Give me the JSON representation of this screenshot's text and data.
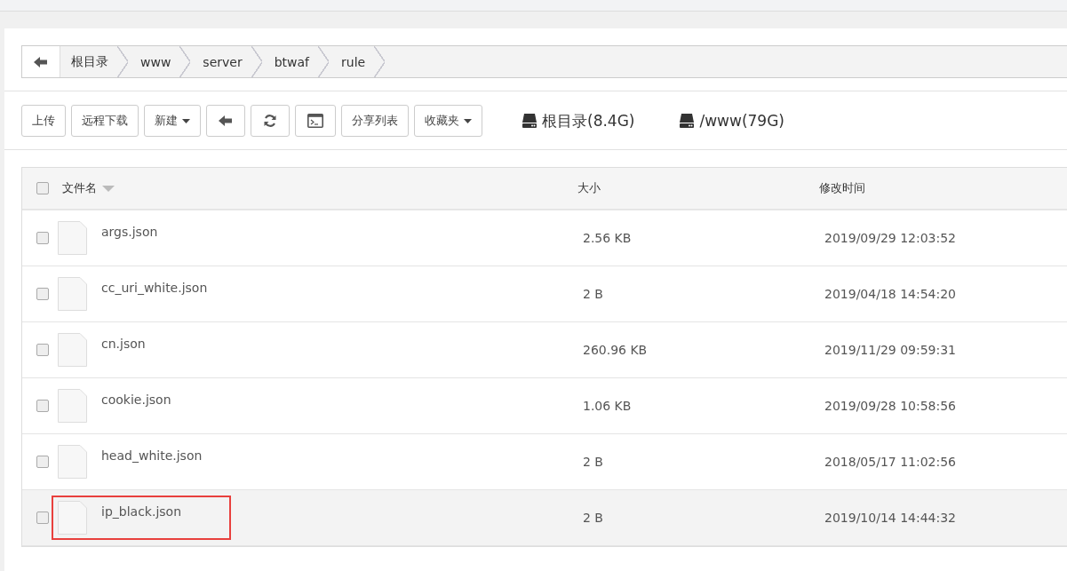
{
  "breadcrumb": {
    "crumbs": [
      "根目录",
      "www",
      "server",
      "btwaf",
      "rule"
    ]
  },
  "toolbar": {
    "buttons": [
      {
        "kind": "text",
        "label": "上传"
      },
      {
        "kind": "text",
        "label": "远程下载"
      },
      {
        "kind": "dropdown",
        "label": "新建"
      },
      {
        "kind": "back"
      },
      {
        "kind": "refresh"
      },
      {
        "kind": "terminal"
      },
      {
        "kind": "text",
        "label": "分享列表"
      },
      {
        "kind": "dropdown",
        "label": "收藏夹"
      }
    ],
    "disks": [
      "根目录(8.4G)",
      "/www(79G)"
    ]
  },
  "table": {
    "all_checked": false,
    "columns": [
      "文件名",
      "大小",
      "修改时间"
    ],
    "rows": [
      {
        "name": "args.json",
        "size": "2.56 KB",
        "modified": "2019/09/29 12:03:52",
        "checked": false,
        "highlighted": false,
        "marked": false
      },
      {
        "name": "cc_uri_white.json",
        "size": "2 B",
        "modified": "2019/04/18 14:54:20",
        "checked": false,
        "highlighted": false,
        "marked": false
      },
      {
        "name": "cn.json",
        "size": "260.96 KB",
        "modified": "2019/11/29 09:59:31",
        "checked": false,
        "highlighted": false,
        "marked": false
      },
      {
        "name": "cookie.json",
        "size": "1.06 KB",
        "modified": "2019/09/28 10:58:56",
        "checked": false,
        "highlighted": false,
        "marked": false
      },
      {
        "name": "head_white.json",
        "size": "2 B",
        "modified": "2018/05/17 11:02:56",
        "checked": false,
        "highlighted": false,
        "marked": false
      },
      {
        "name": "ip_black.json",
        "size": "2 B",
        "modified": "2019/10/14 14:44:32",
        "checked": false,
        "highlighted": true,
        "marked": true
      }
    ]
  }
}
